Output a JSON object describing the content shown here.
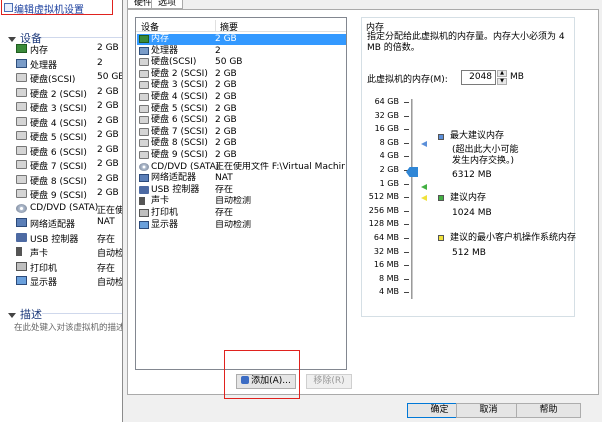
{
  "left_panel": {
    "edit_link": "编辑虚拟机设置",
    "devices_header": "设备",
    "devices": [
      {
        "name": "内存",
        "value": "2 GB",
        "icon": "memory-icon"
      },
      {
        "name": "处理器",
        "value": "2",
        "icon": "processor-icon"
      },
      {
        "name": "硬盘(SCSI)",
        "value": "50 GB",
        "icon": "hard-disk-icon"
      },
      {
        "name": "硬盘 2 (SCSI)",
        "value": "2 GB",
        "icon": "hard-disk-icon"
      },
      {
        "name": "硬盘 3 (SCSI)",
        "value": "2 GB",
        "icon": "hard-disk-icon"
      },
      {
        "name": "硬盘 4 (SCSI)",
        "value": "2 GB",
        "icon": "hard-disk-icon"
      },
      {
        "name": "硬盘 5 (SCSI)",
        "value": "2 GB",
        "icon": "hard-disk-icon"
      },
      {
        "name": "硬盘 6 (SCSI)",
        "value": "2 GB",
        "icon": "hard-disk-icon"
      },
      {
        "name": "硬盘 7 (SCSI)",
        "value": "2 GB",
        "icon": "hard-disk-icon"
      },
      {
        "name": "硬盘 8 (SCSI)",
        "value": "2 GB",
        "icon": "hard-disk-icon"
      },
      {
        "name": "硬盘 9 (SCSI)",
        "value": "2 GB",
        "icon": "hard-disk-icon"
      },
      {
        "name": "CD/DVD (SATA)",
        "value": "正在使",
        "icon": "cd-dvd-icon"
      },
      {
        "name": "网络适配器",
        "value": "NAT",
        "icon": "network-adapter-icon"
      },
      {
        "name": "USB 控制器",
        "value": "存在",
        "icon": "usb-icon"
      },
      {
        "name": "声卡",
        "value": "自动检",
        "icon": "sound-card-icon"
      },
      {
        "name": "打印机",
        "value": "存在",
        "icon": "printer-icon"
      },
      {
        "name": "显示器",
        "value": "自动检",
        "icon": "display-icon"
      }
    ],
    "description_header": "描述",
    "description_hint": "在此处键入对该虚拟机的描述"
  },
  "dialog": {
    "tabs": [
      "硬件",
      "选项"
    ],
    "list_headers": {
      "device": "设备",
      "summary": "摘要"
    },
    "devices": [
      {
        "name": "内存",
        "summary": "2 GB",
        "icon": "memory-icon",
        "selected": true
      },
      {
        "name": "处理器",
        "summary": "2",
        "icon": "processor-icon"
      },
      {
        "name": "硬盘(SCSI)",
        "summary": "50 GB",
        "icon": "hard-disk-icon"
      },
      {
        "name": "硬盘 2 (SCSI)",
        "summary": "2 GB",
        "icon": "hard-disk-icon"
      },
      {
        "name": "硬盘 3 (SCSI)",
        "summary": "2 GB",
        "icon": "hard-disk-icon"
      },
      {
        "name": "硬盘 4 (SCSI)",
        "summary": "2 GB",
        "icon": "hard-disk-icon"
      },
      {
        "name": "硬盘 5 (SCSI)",
        "summary": "2 GB",
        "icon": "hard-disk-icon"
      },
      {
        "name": "硬盘 6 (SCSI)",
        "summary": "2 GB",
        "icon": "hard-disk-icon"
      },
      {
        "name": "硬盘 7 (SCSI)",
        "summary": "2 GB",
        "icon": "hard-disk-icon"
      },
      {
        "name": "硬盘 8 (SCSI)",
        "summary": "2 GB",
        "icon": "hard-disk-icon"
      },
      {
        "name": "硬盘 9 (SCSI)",
        "summary": "2 GB",
        "icon": "hard-disk-icon"
      },
      {
        "name": "CD/DVD (SATA)",
        "summary": "正在使用文件 F:\\Virtual Machines...",
        "icon": "cd-dvd-icon"
      },
      {
        "name": "网络适配器",
        "summary": "NAT",
        "icon": "network-adapter-icon"
      },
      {
        "name": "USB 控制器",
        "summary": "存在",
        "icon": "usb-icon"
      },
      {
        "name": "声卡",
        "summary": "自动检测",
        "icon": "sound-card-icon"
      },
      {
        "name": "打印机",
        "summary": "存在",
        "icon": "printer-icon"
      },
      {
        "name": "显示器",
        "summary": "自动检测",
        "icon": "display-icon"
      }
    ],
    "add_button": "添加(A)...",
    "remove_button": "移除(R)",
    "memory": {
      "group_title": "内存",
      "description": "指定分配给此虚拟机的内存量。内存大小必须为 4 MB 的倍数。",
      "field_label": "此虚拟机的内存(M):",
      "value": "2048",
      "unit": "MB",
      "slider_ticks": [
        "64 GB",
        "32 GB",
        "16 GB",
        "8 GB",
        "4 GB",
        "2 GB",
        "1 GB",
        "512 MB",
        "256 MB",
        "128 MB",
        "64 MB",
        "32 MB",
        "16 MB",
        "8 MB",
        "4 MB"
      ],
      "slider_selected": "2 GB",
      "legend": {
        "max_recommended_label": "最大建议内存",
        "max_recommended_note": "(超出此大小可能\n发生内存交换。)",
        "max_recommended_value": "6312 MB",
        "recommended_label": "建议内存",
        "recommended_value": "1024 MB",
        "min_guest_label": "建议的最小客户机操作系统内存",
        "min_guest_value": "512 MB"
      },
      "colors": {
        "max": "#5b8fd9",
        "recommended": "#43b043",
        "min_guest": "#f0e23a"
      }
    },
    "footer": {
      "ok": "确定",
      "cancel": "取消",
      "help": "帮助"
    }
  }
}
